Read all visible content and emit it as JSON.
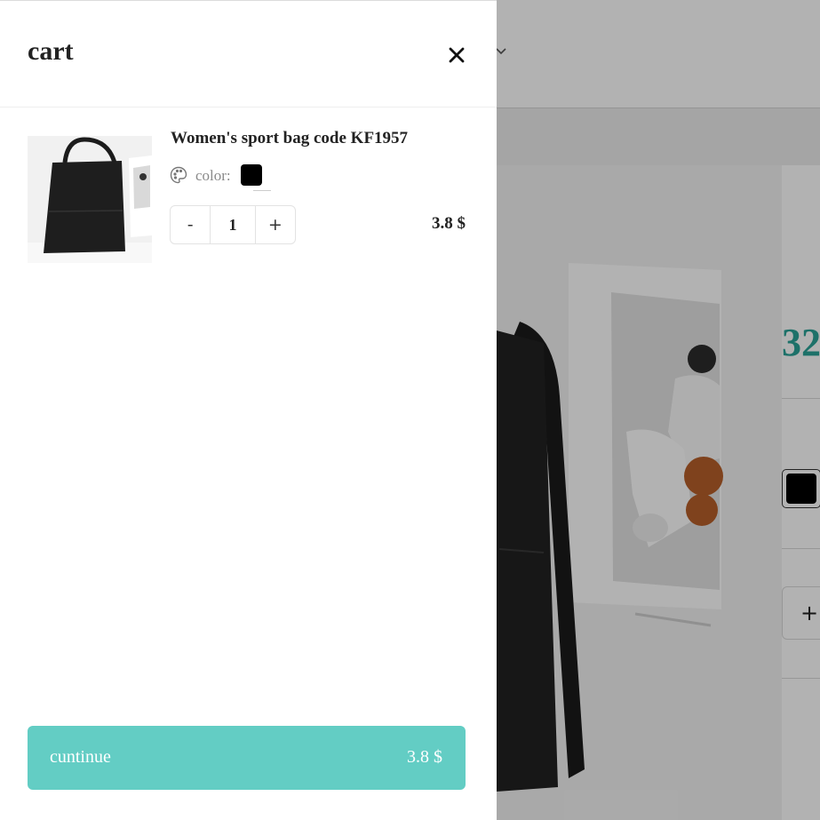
{
  "cart": {
    "title": "cart",
    "items": [
      {
        "name": "Women's sport bag code KF1957",
        "color_label": "color:",
        "color_value": "#000000",
        "quantity": "1",
        "decrease": "-",
        "increase": "+",
        "price": "3.8 $"
      }
    ],
    "checkout": {
      "label": "cuntinue",
      "total": "3.8 $",
      "color": "#63cdc4"
    }
  },
  "background_page": {
    "price_partial": "32",
    "price_color": "#2aa397",
    "plus_label": "+"
  },
  "icons": [
    "close-icon",
    "palette-icon",
    "chevron-down-icon"
  ]
}
